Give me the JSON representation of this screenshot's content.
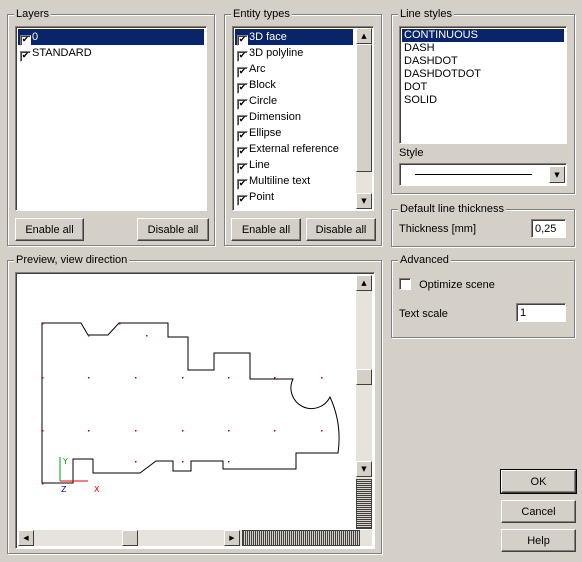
{
  "layers": {
    "title": "Layers",
    "items": [
      {
        "label": "0",
        "checked": true,
        "selected": true
      },
      {
        "label": "STANDARD",
        "checked": true,
        "selected": false
      }
    ],
    "enable_all": "Enable all",
    "disable_all": "Disable all"
  },
  "entity_types": {
    "title": "Entity types",
    "items": [
      {
        "label": "3D face",
        "checked": true,
        "selected": true
      },
      {
        "label": "3D polyline",
        "checked": true
      },
      {
        "label": "Arc",
        "checked": true
      },
      {
        "label": "Block",
        "checked": true
      },
      {
        "label": "Circle",
        "checked": true
      },
      {
        "label": "Dimension",
        "checked": true
      },
      {
        "label": "Ellipse",
        "checked": true
      },
      {
        "label": "External reference",
        "checked": true
      },
      {
        "label": "Line",
        "checked": true
      },
      {
        "label": "Multiline text",
        "checked": true
      },
      {
        "label": "Point",
        "checked": true
      }
    ],
    "enable_all": "Enable all",
    "disable_all": "Disable all"
  },
  "line_styles": {
    "title": "Line styles",
    "items": [
      "CONTINUOUS",
      "DASH",
      "DASHDOT",
      "DASHDOTDOT",
      "DOT",
      "SOLID"
    ],
    "selected": "CONTINUOUS",
    "style_label": "Style"
  },
  "thickness": {
    "title": "Default line thickness",
    "label": "Thickness [mm]",
    "value": "0,25"
  },
  "advanced": {
    "title": "Advanced",
    "optimize_label": "Optimize scene",
    "optimize_checked": false,
    "text_scale_label": "Text scale",
    "text_scale_value": "1"
  },
  "preview": {
    "title": "Preview, view direction",
    "axis_y": "Y",
    "axis_z": "Z",
    "axis_x": "X"
  },
  "buttons": {
    "ok": "OK",
    "cancel": "Cancel",
    "help": "Help"
  },
  "colors": {
    "face": "#d4d0c8",
    "selection": "#0a246a",
    "point_marker": "#c00000",
    "axis_y": "#00a000",
    "axis_x": "#e00000",
    "axis_z": "#0000c0"
  }
}
